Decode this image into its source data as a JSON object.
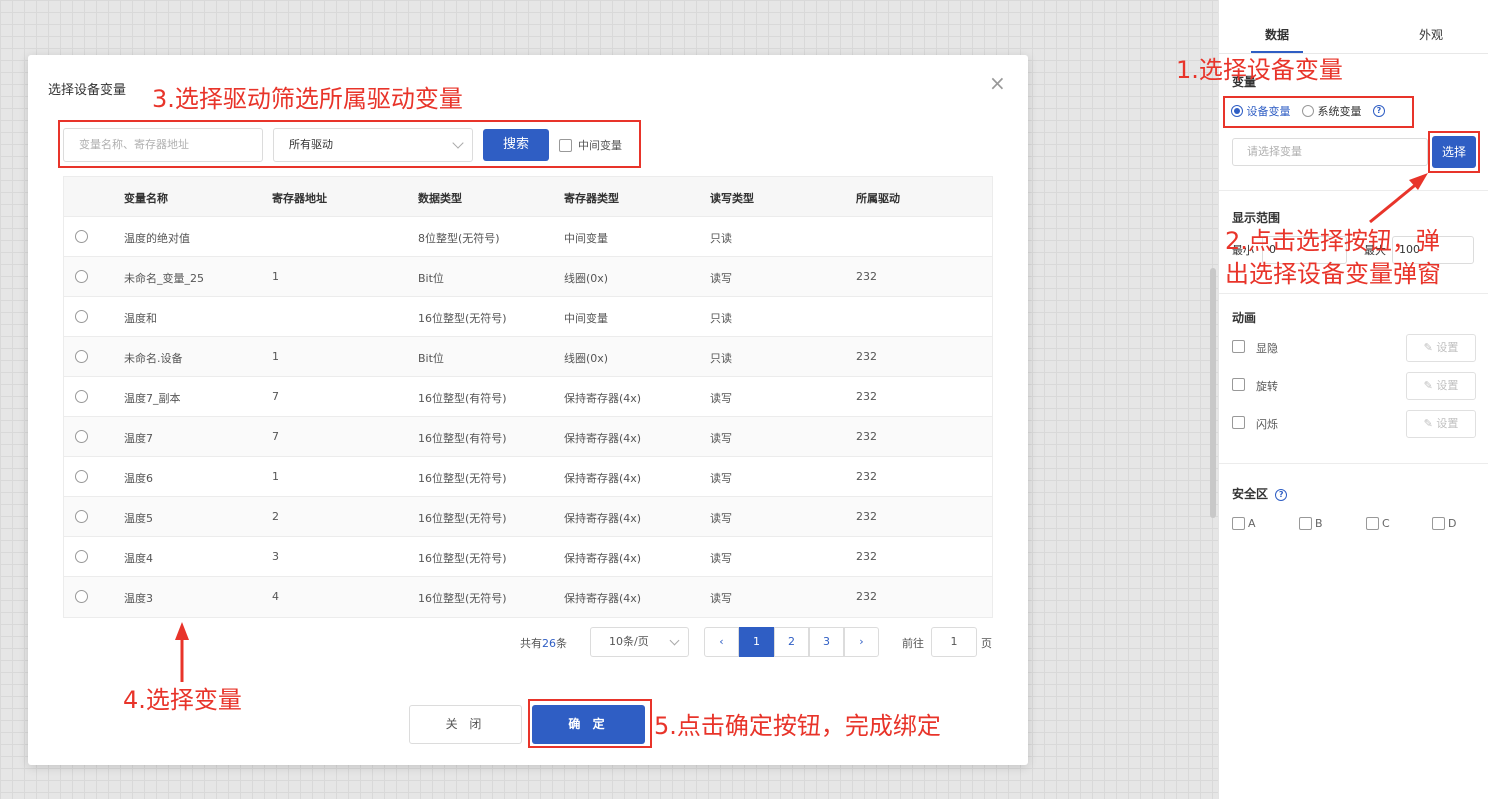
{
  "right_panel": {
    "tabs": [
      "数据",
      "外观"
    ],
    "variable_title": "变量",
    "source_options": [
      "设备变量",
      "系统变量"
    ],
    "variable_placeholder": "请选择变量",
    "choose_label": "选择",
    "range_title": "显示范围",
    "min_label": "最小",
    "min_value": "0",
    "max_label": "最大",
    "max_value": "100",
    "anim_title": "动画",
    "anim_items": [
      "显隐",
      "旋转",
      "闪烁"
    ],
    "set_label": "设置",
    "safe_title": "安全区",
    "safe_items": [
      "A",
      "B",
      "C",
      "D"
    ]
  },
  "dialog": {
    "title": "选择设备变量",
    "search_placeholder": "变量名称、寄存器地址",
    "driver_select": "所有驱动",
    "search_button": "搜索",
    "mid_var_label": "中间变量",
    "columns": [
      "变量名称",
      "寄存器地址",
      "数据类型",
      "寄存器类型",
      "读写类型",
      "所属驱动"
    ],
    "rows": [
      [
        "温度的绝对值",
        "",
        "8位整型(无符号)",
        "中间变量",
        "只读",
        ""
      ],
      [
        "未命名_变量_25",
        "1",
        "Bit位",
        "线圈(0x)",
        "读写",
        "232"
      ],
      [
        "温度和",
        "",
        "16位整型(无符号)",
        "中间变量",
        "只读",
        ""
      ],
      [
        "未命名.设备",
        "1",
        "Bit位",
        "线圈(0x)",
        "只读",
        "232"
      ],
      [
        "温度7_副本",
        "7",
        "16位整型(有符号)",
        "保持寄存器(4x)",
        "读写",
        "232"
      ],
      [
        "温度7",
        "7",
        "16位整型(有符号)",
        "保持寄存器(4x)",
        "读写",
        "232"
      ],
      [
        "温度6",
        "1",
        "16位整型(无符号)",
        "保持寄存器(4x)",
        "读写",
        "232"
      ],
      [
        "温度5",
        "2",
        "16位整型(无符号)",
        "保持寄存器(4x)",
        "读写",
        "232"
      ],
      [
        "温度4",
        "3",
        "16位整型(无符号)",
        "保持寄存器(4x)",
        "读写",
        "232"
      ],
      [
        "温度3",
        "4",
        "16位整型(无符号)",
        "保持寄存器(4x)",
        "读写",
        "232"
      ]
    ],
    "pager": {
      "total_prefix": "共有",
      "total_count": "26",
      "total_suffix": "条",
      "page_size": "10条/页",
      "prev": "‹",
      "pages": [
        "1",
        "2",
        "3"
      ],
      "next": "›",
      "goto_label": "前往",
      "goto_value": "1",
      "page_unit": "页"
    },
    "cancel_button": "关 闭",
    "confirm_button": "确 定",
    "close_icon": "×"
  },
  "annotations": {
    "step1": "1.选择设备变量",
    "step2_line1": "2.点击选择按钮，弹",
    "step2_line2": "出选择设备变量弹窗",
    "step3": "3.选择驱动筛选所属驱动变量",
    "step4": "4.选择变量",
    "step5": "5.点击确定按钮，完成绑定"
  },
  "colors": {
    "primary": "#2f5ec4",
    "annotation": "#e8342a"
  }
}
